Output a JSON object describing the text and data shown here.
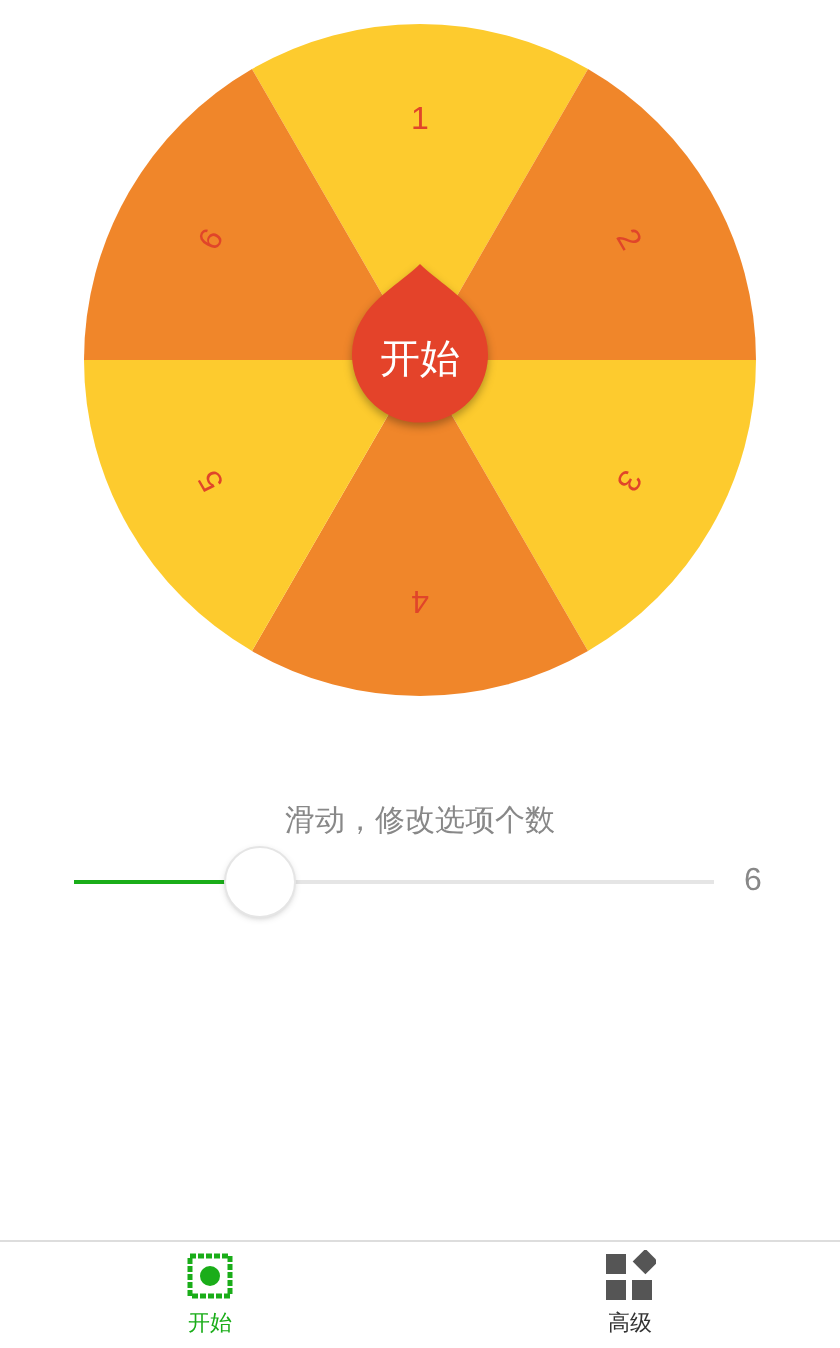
{
  "wheel": {
    "segments": [
      {
        "label": "1",
        "color": "#fdcb2e"
      },
      {
        "label": "2",
        "color": "#f0862a"
      },
      {
        "label": "3",
        "color": "#fdcb2e"
      },
      {
        "label": "4",
        "color": "#f0862a"
      },
      {
        "label": "5",
        "color": "#fdcb2e"
      },
      {
        "label": "6",
        "color": "#f0862a"
      }
    ],
    "start_button": "开始"
  },
  "slider": {
    "caption": "滑动，修改选项个数",
    "level": 0.29,
    "value": "6"
  },
  "tabs": [
    {
      "label": "开始",
      "selected": true,
      "kind": "start"
    },
    {
      "label": "高级",
      "selected": false,
      "kind": "advanced"
    }
  ]
}
